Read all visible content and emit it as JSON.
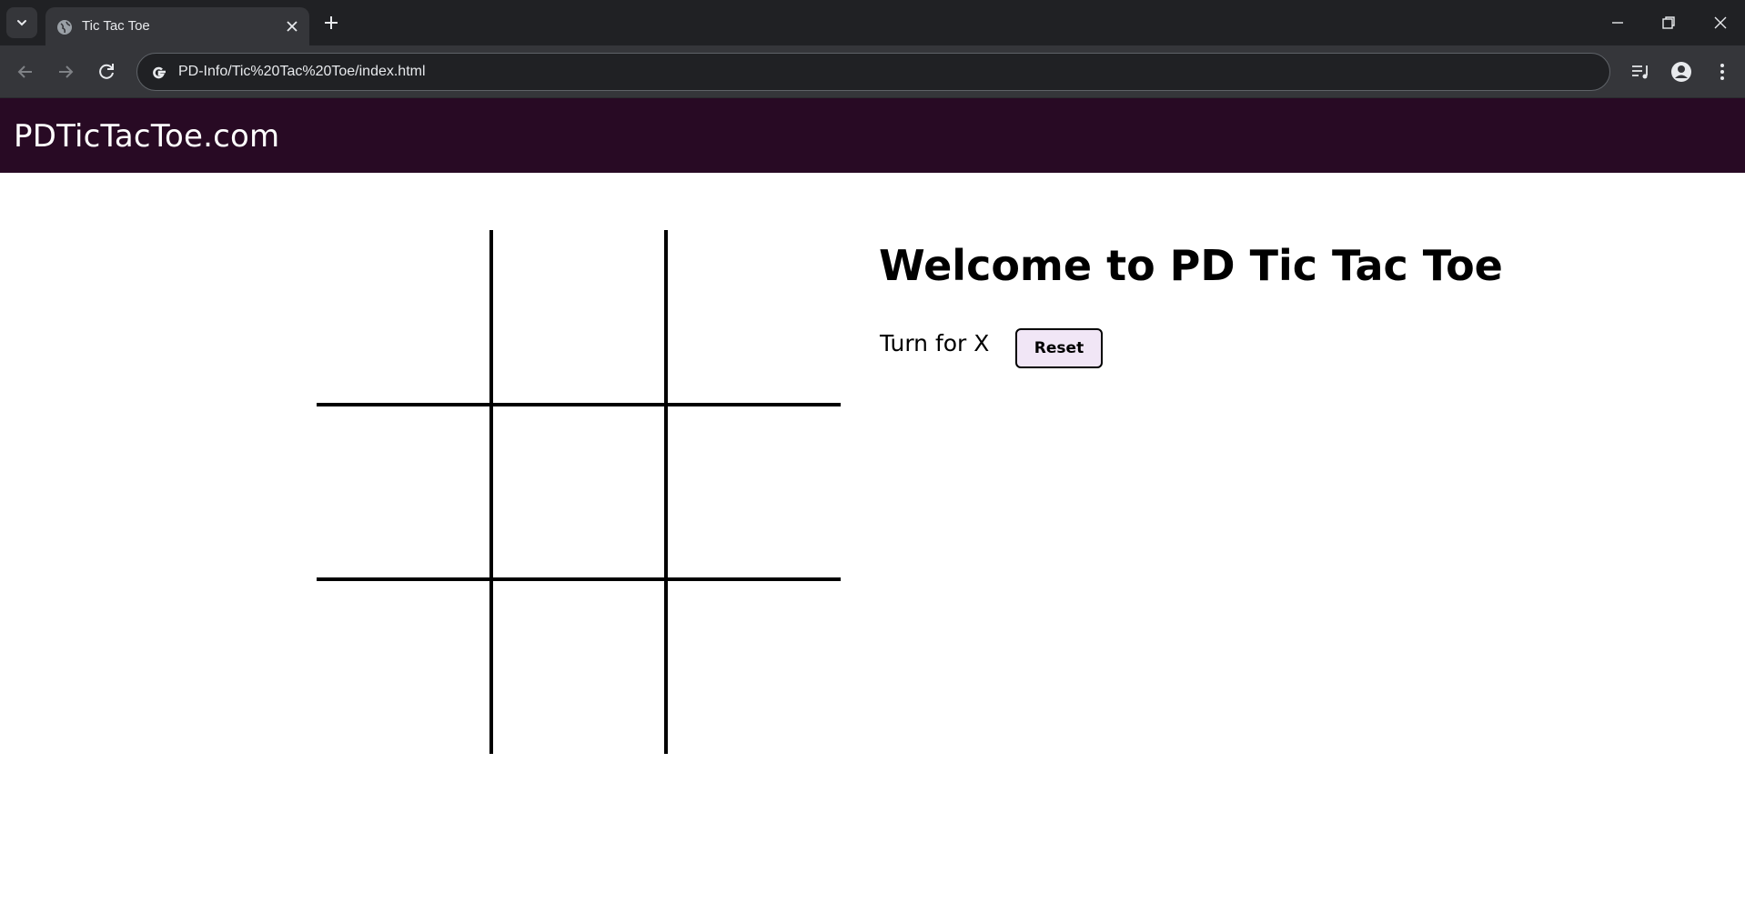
{
  "browser": {
    "tab_title": "Tic Tac Toe",
    "url": "PD-Info/Tic%20Tac%20Toe/index.html",
    "icons": [
      "tab-search-icon",
      "globe-icon",
      "close-icon",
      "plus-icon",
      "minimize-icon",
      "restore-icon",
      "window-close-icon",
      "back-icon",
      "forward-icon",
      "reload-icon",
      "google-icon",
      "media-icon",
      "profile-icon",
      "menu-icon"
    ]
  },
  "site": {
    "brand": "PDTicTacToe.com",
    "header_color": "#280a24"
  },
  "game": {
    "title": "Welcome to PD Tic Tac Toe",
    "turn_text": "Turn for X",
    "reset_label": "Reset",
    "cells": [
      "",
      "",
      "",
      "",
      "",
      "",
      "",
      "",
      ""
    ]
  }
}
